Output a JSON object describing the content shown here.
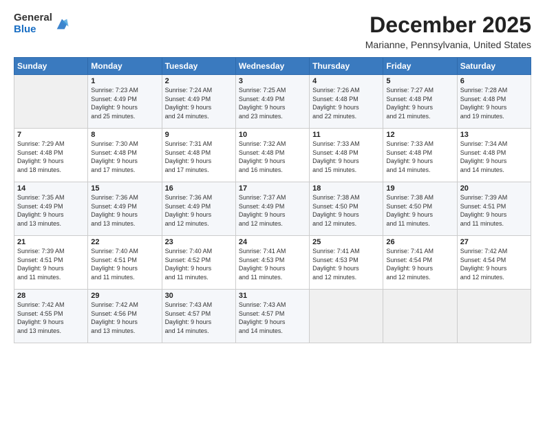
{
  "logo": {
    "general": "General",
    "blue": "Blue"
  },
  "header": {
    "month": "December 2025",
    "location": "Marianne, Pennsylvania, United States"
  },
  "weekdays": [
    "Sunday",
    "Monday",
    "Tuesday",
    "Wednesday",
    "Thursday",
    "Friday",
    "Saturday"
  ],
  "weeks": [
    [
      {
        "day": "",
        "info": ""
      },
      {
        "day": "1",
        "info": "Sunrise: 7:23 AM\nSunset: 4:49 PM\nDaylight: 9 hours\nand 25 minutes."
      },
      {
        "day": "2",
        "info": "Sunrise: 7:24 AM\nSunset: 4:49 PM\nDaylight: 9 hours\nand 24 minutes."
      },
      {
        "day": "3",
        "info": "Sunrise: 7:25 AM\nSunset: 4:49 PM\nDaylight: 9 hours\nand 23 minutes."
      },
      {
        "day": "4",
        "info": "Sunrise: 7:26 AM\nSunset: 4:48 PM\nDaylight: 9 hours\nand 22 minutes."
      },
      {
        "day": "5",
        "info": "Sunrise: 7:27 AM\nSunset: 4:48 PM\nDaylight: 9 hours\nand 21 minutes."
      },
      {
        "day": "6",
        "info": "Sunrise: 7:28 AM\nSunset: 4:48 PM\nDaylight: 9 hours\nand 19 minutes."
      }
    ],
    [
      {
        "day": "7",
        "info": "Sunrise: 7:29 AM\nSunset: 4:48 PM\nDaylight: 9 hours\nand 18 minutes."
      },
      {
        "day": "8",
        "info": "Sunrise: 7:30 AM\nSunset: 4:48 PM\nDaylight: 9 hours\nand 17 minutes."
      },
      {
        "day": "9",
        "info": "Sunrise: 7:31 AM\nSunset: 4:48 PM\nDaylight: 9 hours\nand 17 minutes."
      },
      {
        "day": "10",
        "info": "Sunrise: 7:32 AM\nSunset: 4:48 PM\nDaylight: 9 hours\nand 16 minutes."
      },
      {
        "day": "11",
        "info": "Sunrise: 7:33 AM\nSunset: 4:48 PM\nDaylight: 9 hours\nand 15 minutes."
      },
      {
        "day": "12",
        "info": "Sunrise: 7:33 AM\nSunset: 4:48 PM\nDaylight: 9 hours\nand 14 minutes."
      },
      {
        "day": "13",
        "info": "Sunrise: 7:34 AM\nSunset: 4:48 PM\nDaylight: 9 hours\nand 14 minutes."
      }
    ],
    [
      {
        "day": "14",
        "info": "Sunrise: 7:35 AM\nSunset: 4:49 PM\nDaylight: 9 hours\nand 13 minutes."
      },
      {
        "day": "15",
        "info": "Sunrise: 7:36 AM\nSunset: 4:49 PM\nDaylight: 9 hours\nand 13 minutes."
      },
      {
        "day": "16",
        "info": "Sunrise: 7:36 AM\nSunset: 4:49 PM\nDaylight: 9 hours\nand 12 minutes."
      },
      {
        "day": "17",
        "info": "Sunrise: 7:37 AM\nSunset: 4:49 PM\nDaylight: 9 hours\nand 12 minutes."
      },
      {
        "day": "18",
        "info": "Sunrise: 7:38 AM\nSunset: 4:50 PM\nDaylight: 9 hours\nand 12 minutes."
      },
      {
        "day": "19",
        "info": "Sunrise: 7:38 AM\nSunset: 4:50 PM\nDaylight: 9 hours\nand 11 minutes."
      },
      {
        "day": "20",
        "info": "Sunrise: 7:39 AM\nSunset: 4:51 PM\nDaylight: 9 hours\nand 11 minutes."
      }
    ],
    [
      {
        "day": "21",
        "info": "Sunrise: 7:39 AM\nSunset: 4:51 PM\nDaylight: 9 hours\nand 11 minutes."
      },
      {
        "day": "22",
        "info": "Sunrise: 7:40 AM\nSunset: 4:51 PM\nDaylight: 9 hours\nand 11 minutes."
      },
      {
        "day": "23",
        "info": "Sunrise: 7:40 AM\nSunset: 4:52 PM\nDaylight: 9 hours\nand 11 minutes."
      },
      {
        "day": "24",
        "info": "Sunrise: 7:41 AM\nSunset: 4:53 PM\nDaylight: 9 hours\nand 11 minutes."
      },
      {
        "day": "25",
        "info": "Sunrise: 7:41 AM\nSunset: 4:53 PM\nDaylight: 9 hours\nand 12 minutes."
      },
      {
        "day": "26",
        "info": "Sunrise: 7:41 AM\nSunset: 4:54 PM\nDaylight: 9 hours\nand 12 minutes."
      },
      {
        "day": "27",
        "info": "Sunrise: 7:42 AM\nSunset: 4:54 PM\nDaylight: 9 hours\nand 12 minutes."
      }
    ],
    [
      {
        "day": "28",
        "info": "Sunrise: 7:42 AM\nSunset: 4:55 PM\nDaylight: 9 hours\nand 13 minutes."
      },
      {
        "day": "29",
        "info": "Sunrise: 7:42 AM\nSunset: 4:56 PM\nDaylight: 9 hours\nand 13 minutes."
      },
      {
        "day": "30",
        "info": "Sunrise: 7:43 AM\nSunset: 4:57 PM\nDaylight: 9 hours\nand 14 minutes."
      },
      {
        "day": "31",
        "info": "Sunrise: 7:43 AM\nSunset: 4:57 PM\nDaylight: 9 hours\nand 14 minutes."
      },
      {
        "day": "",
        "info": ""
      },
      {
        "day": "",
        "info": ""
      },
      {
        "day": "",
        "info": ""
      }
    ]
  ]
}
